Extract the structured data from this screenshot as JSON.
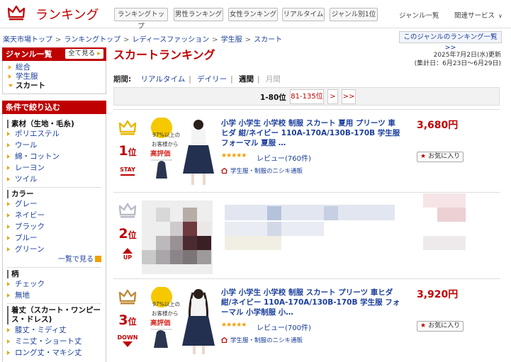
{
  "header": {
    "logo_text": "ランキング",
    "tabs": [
      "ランキングトップ",
      "男性ランキング",
      "女性ランキング",
      "リアルタイム",
      "ジャンル別1位"
    ],
    "genre_list_link": "ジャンル一覧",
    "related_services": "関連サービス"
  },
  "breadcrumb": [
    "楽天市場トップ",
    "ランキングトップ",
    "レディースファッション",
    "学生服",
    "スカート"
  ],
  "genre_ranking_list_button": "このジャンルのランキング一覧>>",
  "sidebar": {
    "genre_title": "ジャンル一覧",
    "show_all": "全て見る",
    "genres": [
      {
        "label": "総合",
        "active": false
      },
      {
        "label": "学生服",
        "active": false
      },
      {
        "label": "スカート",
        "active": true
      }
    ],
    "filter_title": "条件で絞り込む",
    "filters": [
      {
        "heading": "素材（生地・毛糸)",
        "items": [
          "ポリエステル",
          "ウール",
          "綿・コットン",
          "レーヨン",
          "ツイル"
        ]
      },
      {
        "heading": "カラー",
        "items": [
          "グレー",
          "ネイビー",
          "ブラック",
          "ブルー",
          "グリーン"
        ],
        "more": "一覧で見る"
      },
      {
        "heading": "柄",
        "items": [
          "チェック",
          "無地"
        ]
      },
      {
        "heading": "着丈（スカート・ワンピース・ドレス)",
        "items": [
          "膝丈・ミディ丈",
          "ミニ丈・ショート丈",
          "ロング丈・マキシ丈"
        ]
      }
    ]
  },
  "main": {
    "title": "スカートランキング",
    "updated_line1": "2025年7月2日(水)更新",
    "updated_line2": "(集計日：6月23日〜6月29日)",
    "period_label": "期間:",
    "periods": [
      {
        "label": "リアルタイム",
        "state": "link"
      },
      {
        "label": "デイリー",
        "state": "link"
      },
      {
        "label": "週間",
        "state": "selected"
      },
      {
        "label": "月間",
        "state": "disabled"
      }
    ],
    "pager": {
      "current": "1-80位",
      "next_range": "81-135位",
      "next": ">",
      "last": ">>"
    }
  },
  "products": [
    {
      "rank": "1",
      "rank_suffix": "位",
      "trend": "STAY",
      "crown_color": "#e8b800",
      "title": "小学 小学生 小学校 制服 スカート 夏用 プリーツ 車ヒダ 紺/ネイビー 110A-170A/130B-170B 学生服 フォーマル 夏服 …",
      "stars": "★★★★★",
      "review": "レビュー(760件)",
      "shop": "学生服・制服のニシキ通販",
      "price": "3,680円",
      "fav": "お気に入り",
      "badge_line1": "97%以上の",
      "badge_line2": "お客様から",
      "badge_line3": "高評価"
    },
    {
      "rank": "2",
      "rank_suffix": "位",
      "trend": "UP",
      "crown_color": "#b8bcc8"
    },
    {
      "rank": "3",
      "rank_suffix": "位",
      "trend": "DOWN",
      "crown_color": "#c08a3a",
      "title": "小学 小学生 小学校 制服 スカート プリーツ 車ヒダ 紺/ネイビー 110A-170A/130B-170B 学生服 フォーマル 小学制服 小…",
      "stars": "★★★★★",
      "review": "レビュー(700件)",
      "shop": "学生服・制服のニシキ通販",
      "price": "3,920円",
      "fav": "お気に入り",
      "badge_line1": "97%以上の",
      "badge_line2": "お客様から",
      "badge_line3": "高評価"
    }
  ]
}
